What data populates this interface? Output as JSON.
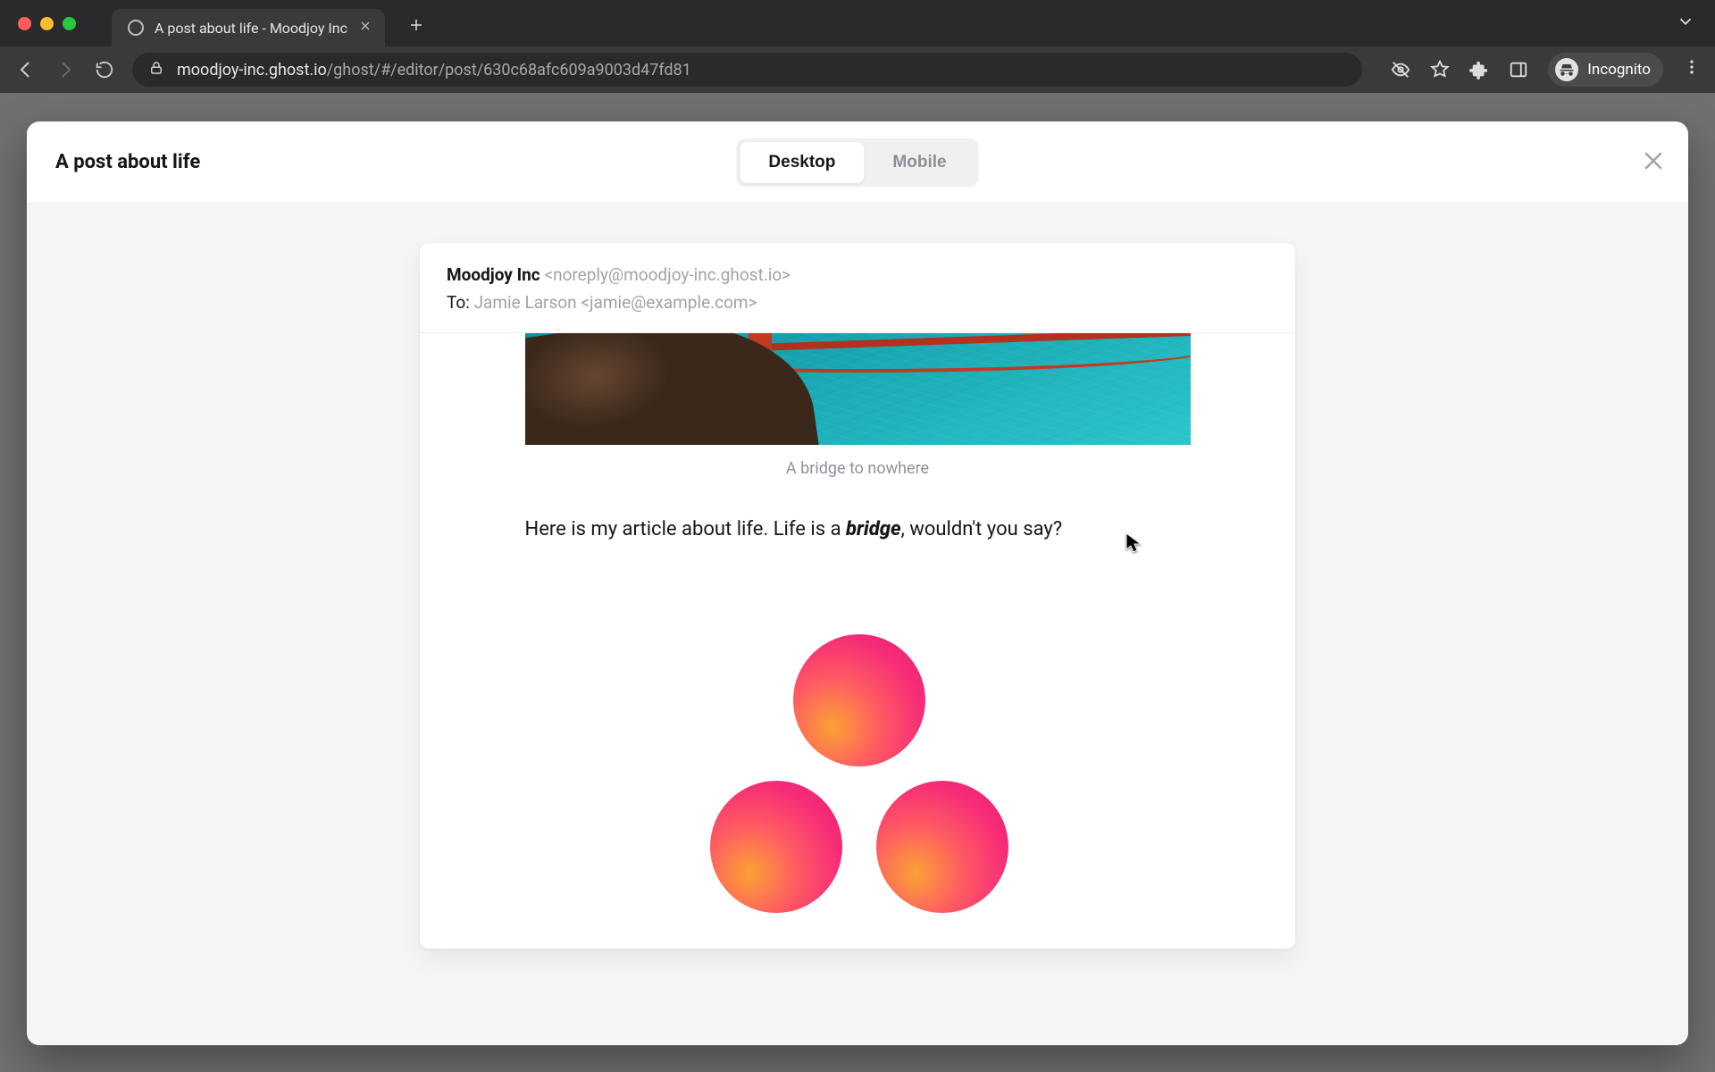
{
  "browser": {
    "tab_title": "A post about life - Moodjoy Inc",
    "new_tab_label": "+",
    "url_host": "moodjoy-inc.ghost.io",
    "url_path": "/ghost/#/editor/post/630c68afc609a9003d47fd81",
    "incognito_label": "Incognito"
  },
  "modal": {
    "title": "A post about life",
    "seg_desktop": "Desktop",
    "seg_mobile": "Mobile"
  },
  "email": {
    "from_name": "Moodjoy Inc",
    "from_email": "<noreply@moodjoy-inc.ghost.io>",
    "to_label": "To:",
    "to_value": "Jamie Larson <jamie@example.com>",
    "image_caption": "A bridge to nowhere",
    "body_before": "Here is my article about life. Life is a ",
    "body_em": "bridge",
    "body_after": ", wouldn't you say?"
  }
}
